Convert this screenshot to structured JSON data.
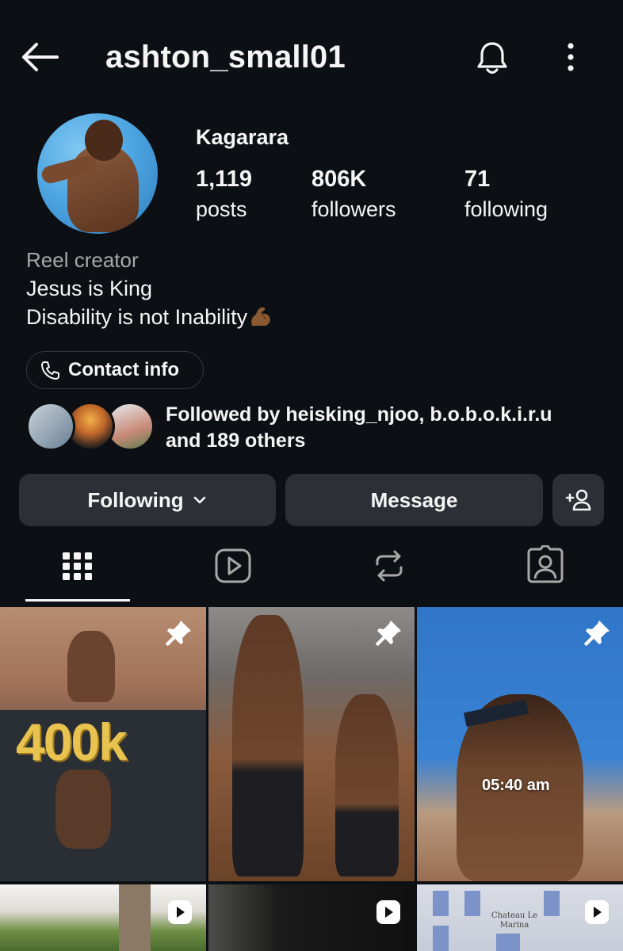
{
  "header": {
    "username": "ashton_small01"
  },
  "profile": {
    "display_name": "Kagarara",
    "stats": [
      {
        "value": "1,119",
        "label": "posts"
      },
      {
        "value": "806K",
        "label": "followers"
      },
      {
        "value": "71",
        "label": "following"
      }
    ],
    "category": "Reel creator",
    "bio_lines": [
      "Jesus is King",
      "Disability is not Inability"
    ],
    "contact_label": "Contact info",
    "followed_by_line1": "Followed by heisking_njoo, b.o.b.o.k.i.r.u",
    "followed_by_line2": "and 189 others"
  },
  "actions": {
    "following_label": "Following",
    "message_label": "Message"
  },
  "tabs": [
    {
      "name": "posts-grid",
      "icon": "grid-icon",
      "active": true
    },
    {
      "name": "reels",
      "icon": "reels-icon",
      "active": false
    },
    {
      "name": "reposts",
      "icon": "repost-icon",
      "active": false
    },
    {
      "name": "tagged",
      "icon": "tagged-icon",
      "active": false
    }
  ],
  "grid": {
    "posts": [
      {
        "pinned": true,
        "type": "image",
        "overlay_text": "400k"
      },
      {
        "pinned": true,
        "type": "image"
      },
      {
        "pinned": true,
        "type": "image",
        "overlay_text": "05:40 am"
      },
      {
        "pinned": false,
        "type": "reel"
      },
      {
        "pinned": false,
        "type": "reel"
      },
      {
        "pinned": false,
        "type": "reel",
        "overlay_text": "Chateau Le Marina"
      }
    ]
  },
  "colors": {
    "background": "#0c1014",
    "button": "#2c3036",
    "secondary_text": "#a8a8a8"
  }
}
